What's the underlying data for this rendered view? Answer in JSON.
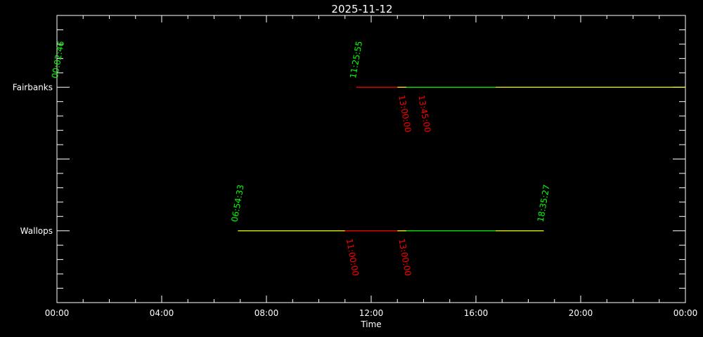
{
  "chart_data": {
    "type": "timeline",
    "title": "2025-11-12",
    "xlabel": "Time",
    "ylabel": "",
    "xlim_hours": [
      0,
      24
    ],
    "x_tick_labels": [
      "00:00",
      "04:00",
      "08:00",
      "12:00",
      "16:00",
      "20:00",
      "00:00"
    ],
    "y_ticks_labels": [
      "Fairbanks",
      "Wallops"
    ],
    "colors": {
      "axis": "#ffffff",
      "start_label": "#00ff00",
      "event_label": "#ff0000",
      "yellow": "#ffff00",
      "red": "#ff0000",
      "green": "#00ff00"
    },
    "stations": [
      {
        "name": "Fairbanks",
        "start_labels": [
          {
            "text": "00:02:46",
            "hour": 0.046
          },
          {
            "text": "11:25:55",
            "hour": 11.432
          }
        ],
        "event_labels": [
          {
            "text": "13:00:00",
            "hour": 13.0
          },
          {
            "text": "13:45:00",
            "hour": 13.75
          }
        ],
        "segments": [
          {
            "start": 11.43,
            "end": 13.0,
            "color": "red"
          },
          {
            "start": 13.0,
            "end": 13.35,
            "color": "yellow"
          },
          {
            "start": 13.35,
            "end": 16.75,
            "color": "green"
          },
          {
            "start": 16.75,
            "end": 24.0,
            "color": "yellow"
          }
        ]
      },
      {
        "name": "Wallops",
        "start_labels": [
          {
            "text": "06:54:33",
            "hour": 6.909
          },
          {
            "text": "18:35:27",
            "hour": 18.591
          }
        ],
        "event_labels": [
          {
            "text": "11:00:00",
            "hour": 11.0
          },
          {
            "text": "13:00:00",
            "hour": 13.0
          }
        ],
        "segments": [
          {
            "start": 6.91,
            "end": 11.0,
            "color": "yellow"
          },
          {
            "start": 11.0,
            "end": 13.0,
            "color": "red"
          },
          {
            "start": 13.0,
            "end": 13.35,
            "color": "yellow"
          },
          {
            "start": 13.35,
            "end": 16.75,
            "color": "green"
          },
          {
            "start": 16.75,
            "end": 18.59,
            "color": "yellow"
          }
        ]
      }
    ]
  }
}
